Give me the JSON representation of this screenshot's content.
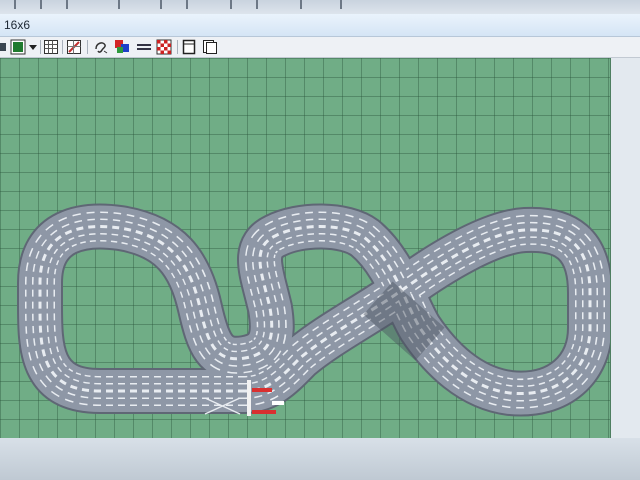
{
  "window": {
    "title": "16x6"
  },
  "toolbar": {
    "items": [
      {
        "name": "line-style-icon"
      },
      {
        "name": "color-picker-icon",
        "color": "#1f7a2e"
      },
      {
        "name": "dropdown-arrow-icon"
      },
      {
        "name": "grid-toggle-icon"
      },
      {
        "name": "eraser-icon"
      },
      {
        "name": "sound-icon"
      },
      {
        "name": "palette-icon"
      },
      {
        "name": "lanes-icon"
      },
      {
        "name": "checkered-flag-icon"
      },
      {
        "name": "page-view-icon"
      },
      {
        "name": "copy-page-icon"
      }
    ]
  },
  "canvas": {
    "grid_color": "#70ad86",
    "track_color": "#8a93a3"
  }
}
